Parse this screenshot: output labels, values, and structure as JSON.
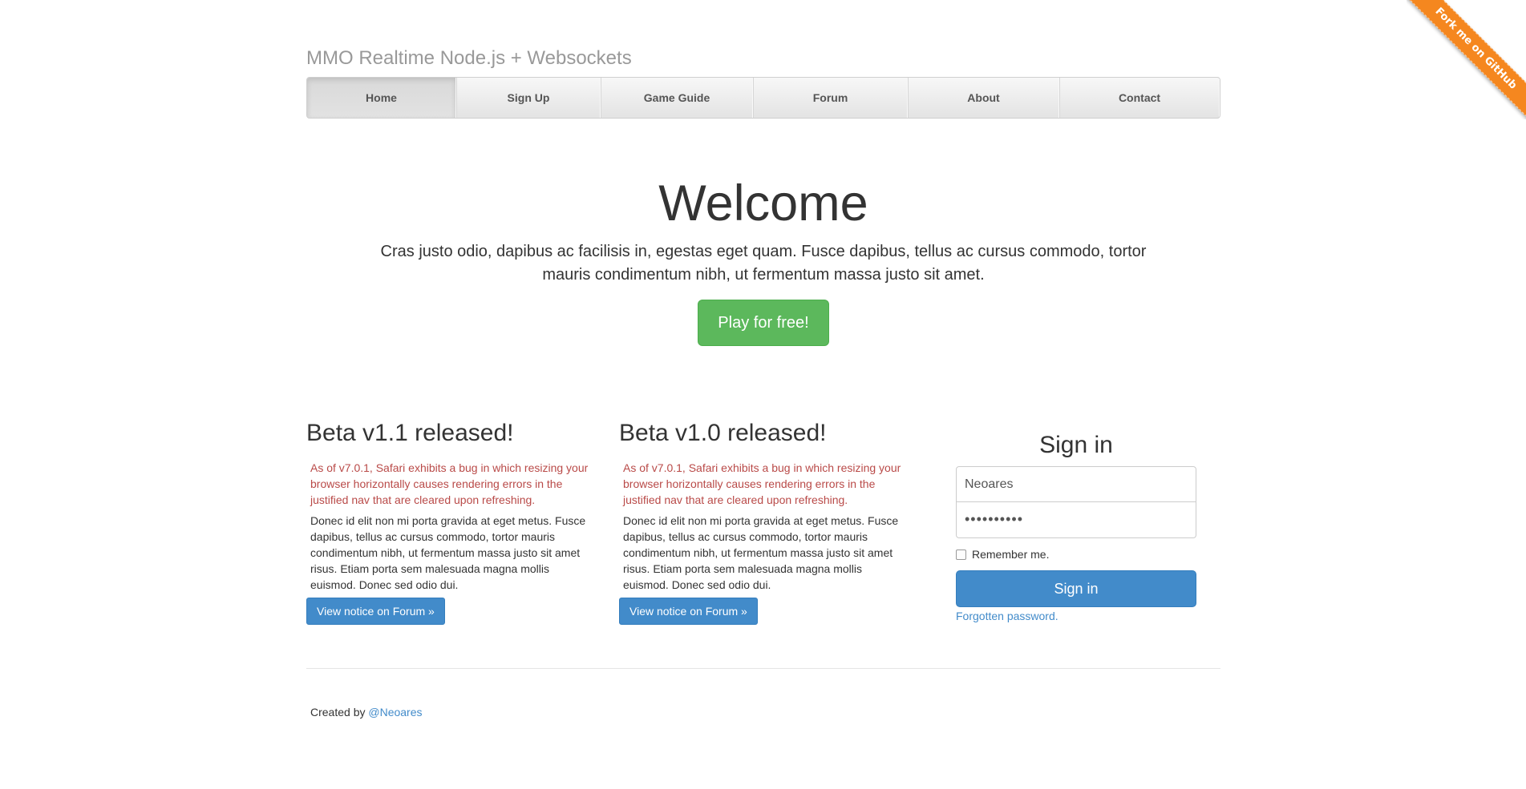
{
  "ribbon": {
    "label": "Fork me on GitHub",
    "color": "#f5871f"
  },
  "header": {
    "site_title": "MMO Realtime Node.js + Websockets"
  },
  "nav": {
    "items": [
      {
        "label": "Home",
        "active": true
      },
      {
        "label": "Sign Up"
      },
      {
        "label": "Game Guide"
      },
      {
        "label": "Forum"
      },
      {
        "label": "About"
      },
      {
        "label": "Contact"
      }
    ]
  },
  "hero": {
    "title": "Welcome",
    "text": "Cras justo odio, dapibus ac facilisis in, egestas eget quam. Fusce dapibus, tellus ac cursus commodo, tortor mauris condimentum nibh, ut fermentum massa justo sit amet.",
    "button_label": "Play for free!",
    "button_color": "#5cb85c"
  },
  "news": [
    {
      "title": "Beta v1.1 released!",
      "alert": "As of v7.0.1, Safari exhibits a bug in which resizing your browser horizontally causes rendering errors in the justified nav that are cleared upon refreshing.",
      "body": "Donec id elit non mi porta gravida at eget metus. Fusce dapibus, tellus ac cursus commodo, tortor mauris condimentum nibh, ut fermentum massa justo sit amet risus. Etiam porta sem malesuada magna mollis euismod. Donec sed odio dui.",
      "button_label": "View notice on Forum »"
    },
    {
      "title": "Beta v1.0 released!",
      "alert": "As of v7.0.1, Safari exhibits a bug in which resizing your browser horizontally causes rendering errors in the justified nav that are cleared upon refreshing.",
      "body": "Donec id elit non mi porta gravida at eget metus. Fusce dapibus, tellus ac cursus commodo, tortor mauris condimentum nibh, ut fermentum massa justo sit amet risus. Etiam porta sem malesuada magna mollis euismod. Donec sed odio dui.",
      "button_label": "View notice on Forum »"
    }
  ],
  "signin": {
    "title": "Sign in",
    "username_value": "Neoares",
    "password_value": "••••••••••",
    "remember_label": "Remember me.",
    "button_label": "Sign in",
    "forgot_label": "Forgotten password.",
    "accent_color": "#428bca"
  },
  "footer": {
    "created_by": "Created by",
    "author_link": "@Neoares"
  }
}
